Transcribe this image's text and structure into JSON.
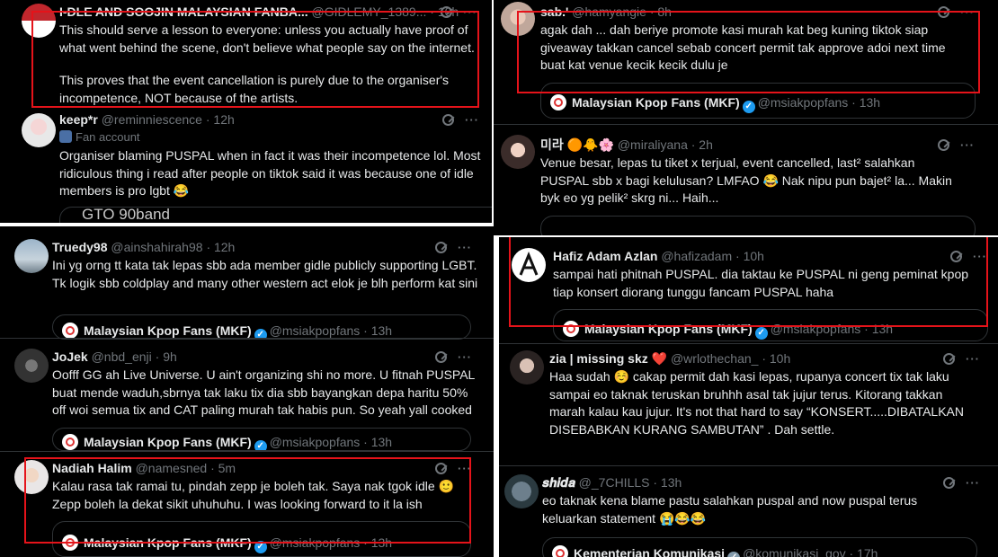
{
  "topLeft": {
    "tweet1": {
      "name": "I-DLE AND SOOJIN MALAYSIAN FANBA...",
      "handle": "@GIDLEMY_1389...",
      "time": "· 10h",
      "body1": "This should serve a lesson to everyone: unless you actually have proof of what went behind the scene, don't believe what people say on the internet.",
      "body2": "This proves that the event cancellation is purely due to the organiser's incompetence, NOT because of the artists."
    },
    "tweet2": {
      "name": "keep*r",
      "handle": "@reminniescence",
      "time": "· 12h",
      "fan_label": "Fan account",
      "body": "Organiser blaming PUSPAL when in fact it was their incompetence lol. Most ridiculous thing i read after people on tiktok said it was because one of idle members is pro lgbt 😂",
      "quote_text": "GTO 90band"
    }
  },
  "bottomLeft": {
    "tweet1": {
      "name": "Truedy98",
      "handle": "@ainshahirah98",
      "time": "· 12h",
      "body": "Ini yg orng tt kata tak lepas sbb ada member gidle publicly supporting LGBT. Tk logik sbb coldplay and many other western act elok je blh perform kat sini",
      "quote_name": "Malaysian Kpop Fans (MKF)",
      "quote_handle": "@msiakpopfans · 13h"
    },
    "tweet2": {
      "name": "JoJek",
      "handle": "@nbd_enji",
      "time": "· 9h",
      "body": "Oofff GG ah Live Universe. U ain't organizing shi no more. U fitnah PUSPAL buat mende waduh,sbrnya tak laku tix dia sbb bayangkan depa haritu 50% off woi semua tix and CAT paling murah tak habis pun. So yeah yall cooked",
      "quote_name": "Malaysian Kpop Fans (MKF)",
      "quote_handle": "@msiakpopfans · 13h"
    },
    "tweet3": {
      "name": "Nadiah Halim",
      "handle": "@namesned",
      "time": "· 5m",
      "body": "Kalau rasa tak ramai tu, pindah zepp je boleh tak. Saya nak tgok idle 🙂 Zepp boleh la dekat sikit uhuhuhu. I was looking forward to it la ish",
      "quote_name": "Malaysian Kpop Fans (MKF)",
      "quote_handle": "@msiakpopfans · 13h"
    }
  },
  "topRight": {
    "tweet1": {
      "name": "sab.'",
      "handle": "@hamyangie",
      "time": "· 8h",
      "body": "agak dah ... dah beriye promote kasi murah kat beg kuning tiktok siap giveaway takkan cancel sebab concert permit tak approve adoi next time buat kat venue kecik kecik dulu je",
      "quote_name": "Malaysian Kpop Fans (MKF)",
      "quote_handle": "@msiakpopfans · 13h"
    },
    "tweet2": {
      "name": "미라 🟠🐥🌸",
      "handle": "@miraliyana",
      "time": "· 2h",
      "body": "Venue besar, lepas tu tiket x terjual, event cancelled, last² salahkan PUSPAL sbb x bagi kelulusan? LMFAO 😂 Nak nipu pun bajet² la... Makin byk eo yg pelik² skrg ni... Haih..."
    }
  },
  "bottomRight": {
    "tweet1": {
      "name": "Hafiz Adam Azlan",
      "handle": "@hafizadam",
      "time": "· 10h",
      "body": "sampai hati phitnah PUSPAL. dia taktau ke PUSPAL ni geng peminat kpop tiap konsert diorang tunggu fancam PUSPAL haha",
      "quote_name": "Malaysian Kpop Fans (MKF)",
      "quote_handle": "@msiakpopfans · 13h"
    },
    "tweet2": {
      "name": "zia | missing skz ❤️",
      "handle": "@wrlothechan_",
      "time": "· 10h",
      "body": "Haa sudah ☺️ cakap permit dah kasi lepas, rupanya concert tix tak laku sampai eo taknak teruskan bruhhh asal tak jujur terus. Kitorang takkan marah kalau kau jujur. It's not that hard to say “KONSERT.....DIBATALKAN DISEBABKAN KURANG SAMBUTAN” . Dah settle."
    },
    "tweet3": {
      "name": "𝒔𝒉𝒊𝒅𝒂",
      "handle": "@_7CHILLS",
      "time": "· 13h",
      "body": "eo taknak kena blame pastu salahkan puspal and now puspal terus keluarkan statement 😭😂😂",
      "quote_name": "Kementerian Komunikasi",
      "quote_handle": "@komunikasi_gov · 17h"
    }
  },
  "colors": {
    "highlight": "#e5131a",
    "background": "#000000",
    "verified": "#1d9bf0"
  }
}
